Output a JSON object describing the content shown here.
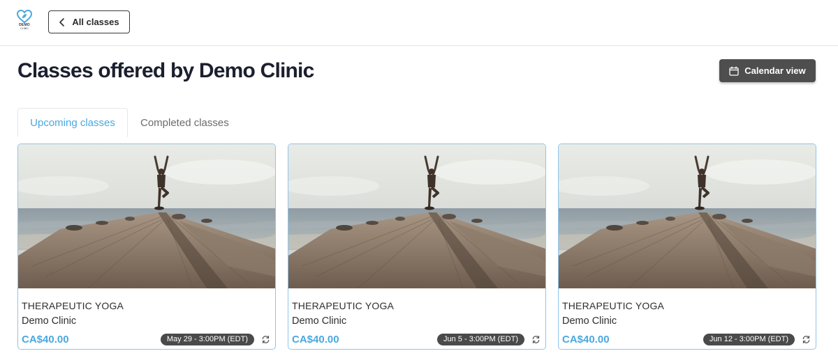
{
  "header": {
    "logo": {
      "icon": "heart-leaf-logo",
      "text": "DEMO",
      "subtext": "CLINIC",
      "accent": "#4aa8e0"
    },
    "back_button": {
      "label": "All classes",
      "icon": "chevron-left-icon"
    }
  },
  "page": {
    "title": "Classes offered by Demo Clinic",
    "calendar_button": {
      "label": "Calendar view",
      "icon": "calendar-icon",
      "bg": "#4e4e4e"
    }
  },
  "tabs": [
    {
      "label": "Upcoming classes",
      "active": true
    },
    {
      "label": "Completed classes",
      "active": false
    }
  ],
  "classes": [
    {
      "title": "THERAPEUTIC YOGA",
      "org": "Demo Clinic",
      "price": "CA$40.00",
      "date": "May 29 - 3:00PM (EDT)",
      "recurring_icon": "recurring-icon",
      "image": "yoga-pose-on-pier-photo"
    },
    {
      "title": "THERAPEUTIC YOGA",
      "org": "Demo Clinic",
      "price": "CA$40.00",
      "date": "Jun 5 - 3:00PM (EDT)",
      "recurring_icon": "recurring-icon",
      "image": "yoga-pose-on-pier-photo"
    },
    {
      "title": "THERAPEUTIC YOGA",
      "org": "Demo Clinic",
      "price": "CA$40.00",
      "date": "Jun 12 - 3:00PM (EDT)",
      "recurring_icon": "recurring-icon",
      "image": "yoga-pose-on-pier-photo"
    }
  ],
  "colors": {
    "accent": "#4aa8e0",
    "card_border": "#8ec5ee",
    "badge_bg": "#4a4a4a"
  }
}
